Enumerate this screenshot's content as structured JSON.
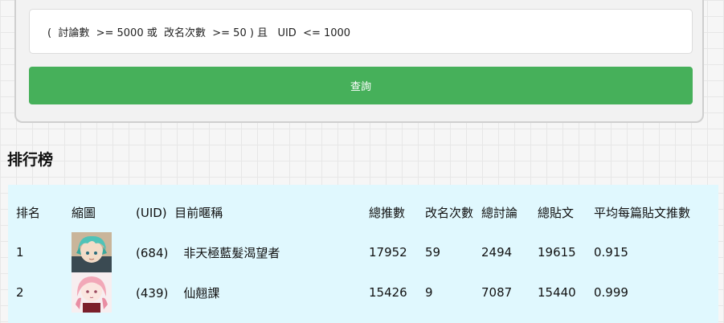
{
  "query": {
    "text": "(  討論數  >= 5000 或  改名次數  >= 50 ) 且   UID  <= 1000"
  },
  "query_button": {
    "label": "查詢"
  },
  "leaderboard": {
    "title": "排行榜",
    "headers": {
      "rank": "排名",
      "thumbnail": "縮圖",
      "uid_name": "(UID)  目前暱稱",
      "total_push": "總推數",
      "rename_count": "改名次數",
      "total_discussion": "總討論",
      "total_posts": "總貼文",
      "avg_push_per_post": "平均每篇貼文推數"
    },
    "rows": [
      {
        "rank": "1",
        "uid_name": "(684)    非天極藍髮渴望者",
        "total_push": "17952",
        "rename_count": "59",
        "total_discussion": "2494",
        "total_posts": "19615",
        "avg_push_per_post": "0.915"
      },
      {
        "rank": "2",
        "uid_name": "(439)    仙翹課",
        "total_push": "15426",
        "rename_count": "9",
        "total_discussion": "7087",
        "total_posts": "15440",
        "avg_push_per_post": "0.999"
      }
    ]
  },
  "colors": {
    "button": "#46b05a",
    "table_bg": "#e0f8fe"
  }
}
